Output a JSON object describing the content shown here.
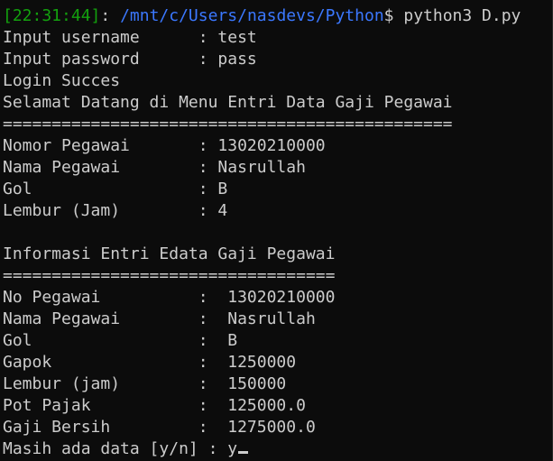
{
  "prompt": {
    "timestamp": "[22:31:44]",
    "separator": ": ",
    "path": "/mnt/c/Users/nasdevs/Python",
    "symbol": "$",
    "command": " python3 D.py"
  },
  "output_lines": [
    "Input username      : test",
    "Input password      : pass",
    "Login Succes",
    "Selamat Datang di Menu Entri Data Gaji Pegawai",
    "==============================================",
    "Nomor Pegawai       : 13020210000",
    "Nama Pegawai        : Nasrullah",
    "Gol                 : B",
    "Lembur (Jam)        : 4",
    "",
    "Informasi Entri Edata Gaji Pegawai",
    "==================================",
    "No Pegawai          :  13020210000",
    "Nama Pegawai        :  Nasrullah",
    "Gol                 :  B",
    "Gapok               :  1250000",
    "Lembur (jam)        :  150000",
    "Pot Pajak           :  125000.0",
    "Gaji Bersih         :  1275000.0"
  ],
  "input_prompt": {
    "label": "Masih ada data [y/n] : ",
    "value": "y"
  },
  "colors": {
    "background": "#0c0c0c",
    "text": "#cccccc",
    "timestamp": "#13a10e",
    "path": "#3b78ff"
  }
}
